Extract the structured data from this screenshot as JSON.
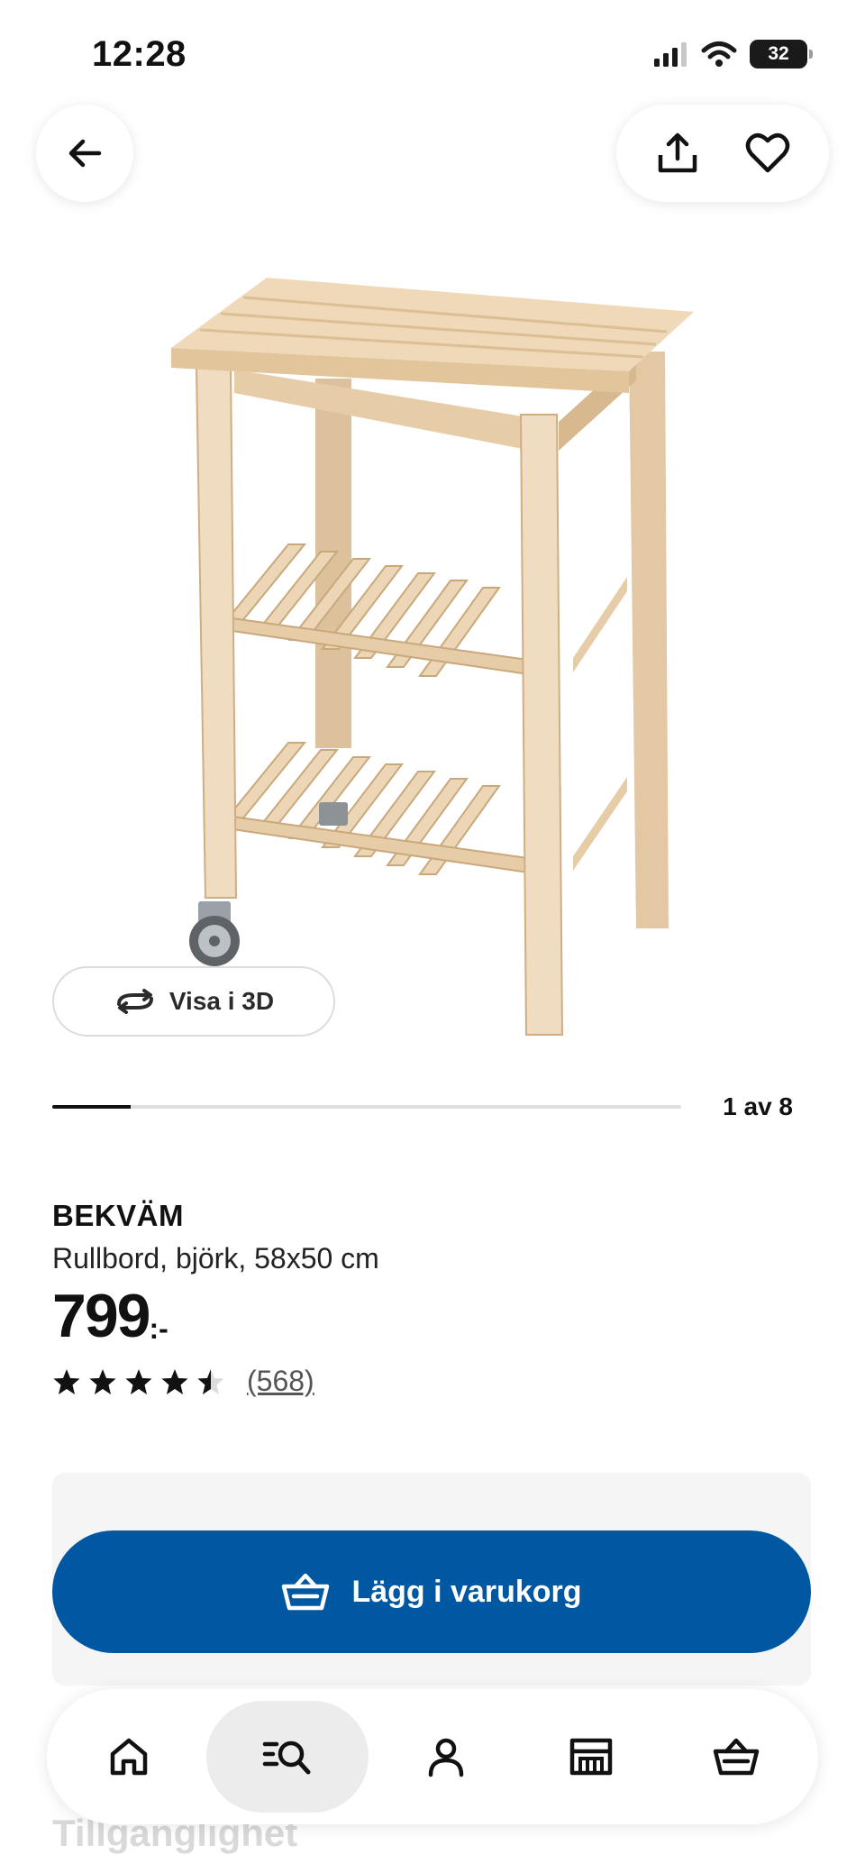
{
  "status_bar": {
    "time": "12:28",
    "battery": "32"
  },
  "product": {
    "brand": "BEKVÄM",
    "description": "Rullbord, björk, 58x50 cm",
    "price": "799",
    "price_suffix": ":-",
    "rating": 4.5,
    "review_count": "(568)"
  },
  "gallery": {
    "view_3d_label": "Visa i 3D",
    "counter": "1 av 8",
    "current": 1,
    "total": 8
  },
  "cart": {
    "add_label": "Lägg i varukorg"
  },
  "obscured_heading": "Tillgänglighet",
  "bottom_nav": {
    "items": [
      {
        "icon": "home-icon",
        "active": false
      },
      {
        "icon": "search-icon",
        "active": true
      },
      {
        "icon": "profile-icon",
        "active": false
      },
      {
        "icon": "store-icon",
        "active": false
      },
      {
        "icon": "basket-icon",
        "active": false
      }
    ]
  },
  "colors": {
    "primary": "#0058a3",
    "wood": "#e8cfae",
    "text": "#111111"
  }
}
